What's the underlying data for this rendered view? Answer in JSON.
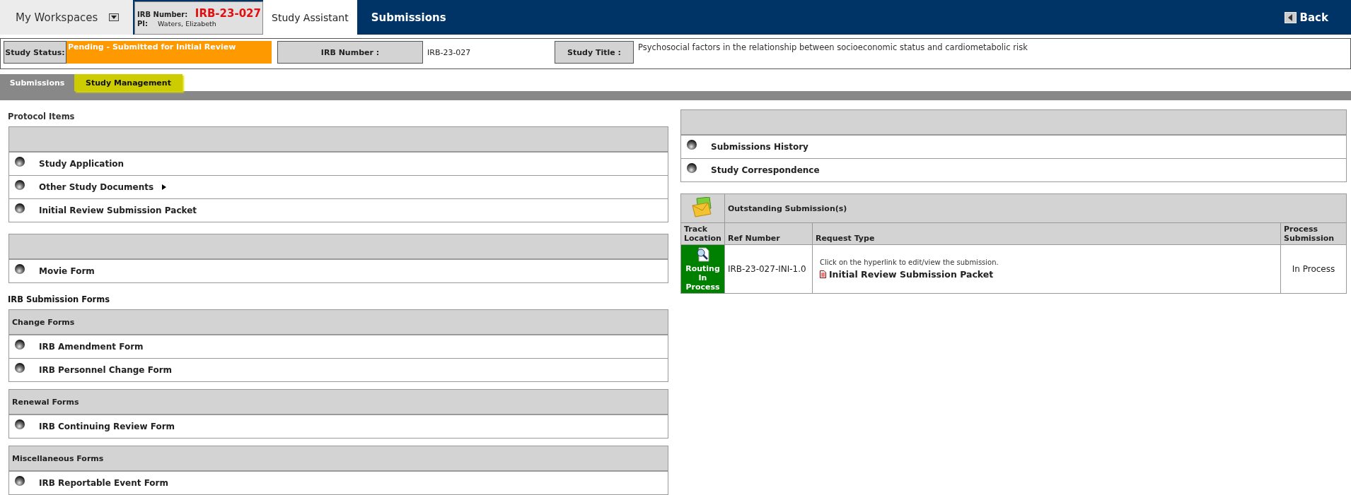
{
  "header": {
    "workspace_menu": "My Workspaces",
    "irb_label": "IRB Number:",
    "irb_number": "IRB-23-027",
    "pi_label": "PI:",
    "pi_name": "Waters, Elizabeth",
    "tabs": [
      {
        "label": "Study Assistant",
        "selected": true
      },
      {
        "label": "Submissions",
        "selected": false
      }
    ],
    "back": "Back"
  },
  "status_bar": {
    "status_label": "Study Status:",
    "status_value": "Pending - Submitted for Initial Review",
    "irb_label": "IRB Number :",
    "irb_value": "IRB-23-027",
    "title_label": "Study Title :",
    "title_value": "Psychosocial factors in the relationship between socioeconomic status and cardiometabolic risk"
  },
  "subtabs": [
    {
      "label": "Submissions",
      "selected": false
    },
    {
      "label": "Study Management",
      "selected": true
    }
  ],
  "protocol_items": {
    "title": "Protocol Items",
    "panels": [
      {
        "items": [
          {
            "label": "Study Application",
            "has_submenu": false
          },
          {
            "label": "Other Study Documents",
            "has_submenu": true
          },
          {
            "label": "Initial Review Submission Packet",
            "has_submenu": false
          }
        ]
      },
      {
        "items": [
          {
            "label": "Movie Form",
            "has_submenu": false
          }
        ]
      }
    ]
  },
  "irb_submission_forms": {
    "title": "IRB Submission Forms",
    "panels": [
      {
        "heading": "Change Forms",
        "items": [
          {
            "label": "IRB Amendment Form",
            "has_submenu": false
          },
          {
            "label": "IRB Personnel Change Form",
            "has_submenu": false
          }
        ]
      },
      {
        "heading": "Renewal Forms",
        "items": [
          {
            "label": "IRB Continuing Review Form",
            "has_submenu": false
          }
        ]
      },
      {
        "heading": "Miscellaneous Forms",
        "items": [
          {
            "label": "IRB Reportable Event Form",
            "has_submenu": false
          }
        ]
      }
    ]
  },
  "study_links": {
    "items": [
      {
        "label": "Submissions History",
        "has_submenu": false
      },
      {
        "label": "Study Correspondence",
        "has_submenu": false
      }
    ]
  },
  "outstanding": {
    "title": "Outstanding Submission(s)",
    "columns": [
      "Track Location",
      "Ref Number",
      "Request Type",
      "Process Submission"
    ],
    "rows": [
      {
        "track_location": "Routing In Process",
        "ref_number": "IRB-23-027-INI-1.0",
        "hint": "Click on the hyperlink to edit/view the submission.",
        "request_type": "Initial Review Submission Packet",
        "process_submission": "In Process"
      }
    ]
  }
}
